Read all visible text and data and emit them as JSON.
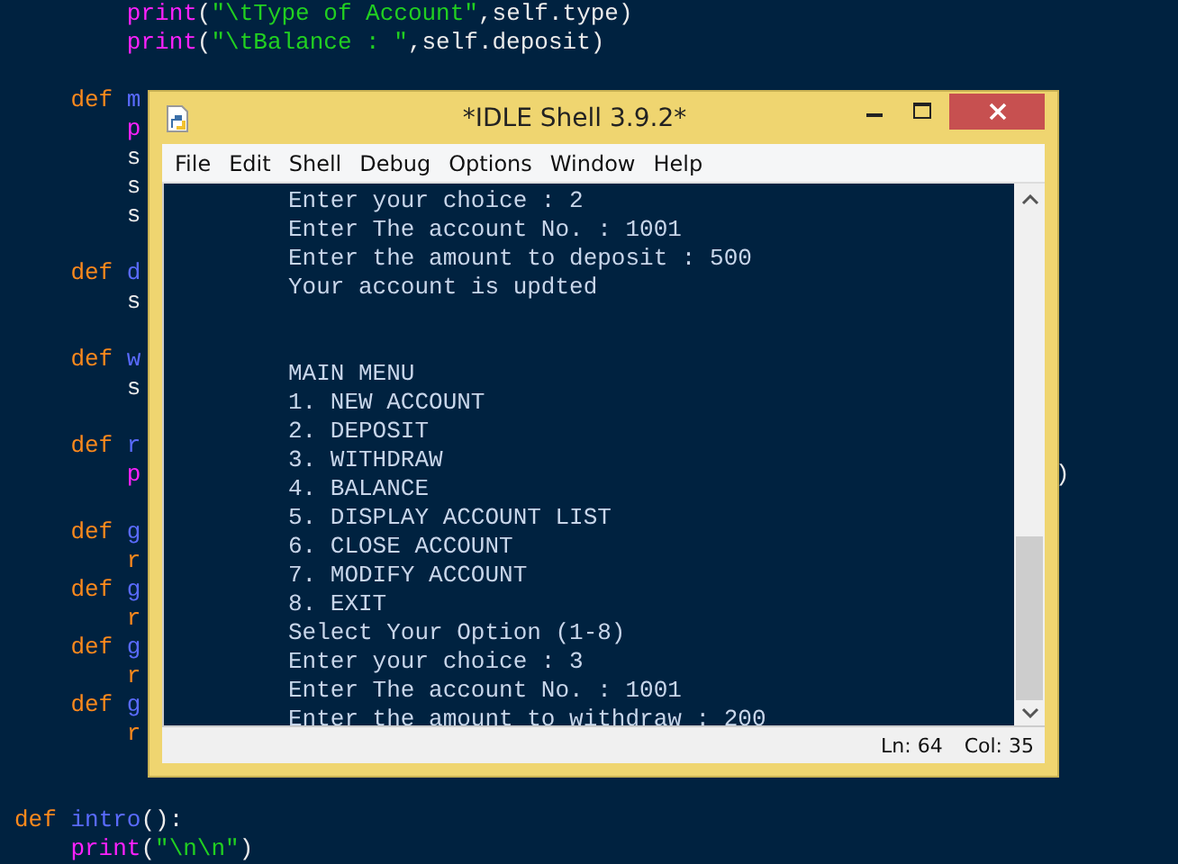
{
  "editor": {
    "lines": [
      {
        "kind": "code",
        "segments": [
          {
            "kind": "builtin",
            "text": "        print"
          },
          {
            "kind": "plain",
            "text": "("
          },
          {
            "kind": "string",
            "text": "\"\\tType of Account\""
          },
          {
            "kind": "plain",
            "text": ",self.type)"
          }
        ]
      },
      {
        "kind": "code",
        "segments": [
          {
            "kind": "builtin",
            "text": "        print"
          },
          {
            "kind": "plain",
            "text": "("
          },
          {
            "kind": "string",
            "text": "\"\\tBalance : \""
          },
          {
            "kind": "plain",
            "text": ",self.deposit)"
          }
        ]
      },
      {
        "kind": "blank"
      },
      {
        "kind": "code",
        "segments": [
          {
            "kind": "keyword",
            "text": "    def "
          },
          {
            "kind": "name",
            "text": "m"
          }
        ]
      },
      {
        "kind": "code",
        "segments": [
          {
            "kind": "builtin",
            "text": "        p"
          }
        ]
      },
      {
        "kind": "code",
        "segments": [
          {
            "kind": "plain",
            "text": "        s"
          }
        ]
      },
      {
        "kind": "code",
        "segments": [
          {
            "kind": "plain",
            "text": "        s"
          }
        ]
      },
      {
        "kind": "code",
        "segments": [
          {
            "kind": "plain",
            "text": "        s"
          }
        ]
      },
      {
        "kind": "blank"
      },
      {
        "kind": "code",
        "segments": [
          {
            "kind": "keyword",
            "text": "    def "
          },
          {
            "kind": "name",
            "text": "d"
          }
        ]
      },
      {
        "kind": "code",
        "segments": [
          {
            "kind": "plain",
            "text": "        s"
          }
        ]
      },
      {
        "kind": "blank"
      },
      {
        "kind": "code",
        "segments": [
          {
            "kind": "keyword",
            "text": "    def "
          },
          {
            "kind": "name",
            "text": "w"
          }
        ]
      },
      {
        "kind": "code",
        "segments": [
          {
            "kind": "plain",
            "text": "        s"
          }
        ]
      },
      {
        "kind": "blank"
      },
      {
        "kind": "code",
        "segments": [
          {
            "kind": "keyword",
            "text": "    def "
          },
          {
            "kind": "name",
            "text": "r"
          }
        ]
      },
      {
        "kind": "code",
        "segments": [
          {
            "kind": "builtin",
            "text": "        p"
          }
        ],
        "right": ")"
      },
      {
        "kind": "blank"
      },
      {
        "kind": "code",
        "segments": [
          {
            "kind": "keyword",
            "text": "    def "
          },
          {
            "kind": "name",
            "text": "g"
          }
        ]
      },
      {
        "kind": "code",
        "segments": [
          {
            "kind": "keyword",
            "text": "        r"
          }
        ]
      },
      {
        "kind": "code",
        "segments": [
          {
            "kind": "keyword",
            "text": "    def "
          },
          {
            "kind": "name",
            "text": "g"
          }
        ]
      },
      {
        "kind": "code",
        "segments": [
          {
            "kind": "keyword",
            "text": "        r"
          }
        ]
      },
      {
        "kind": "code",
        "segments": [
          {
            "kind": "keyword",
            "text": "    def "
          },
          {
            "kind": "name",
            "text": "g"
          }
        ]
      },
      {
        "kind": "code",
        "segments": [
          {
            "kind": "keyword",
            "text": "        r"
          }
        ]
      },
      {
        "kind": "code",
        "segments": [
          {
            "kind": "keyword",
            "text": "    def "
          },
          {
            "kind": "name",
            "text": "g"
          }
        ]
      },
      {
        "kind": "code",
        "segments": [
          {
            "kind": "keyword",
            "text": "        r"
          }
        ]
      },
      {
        "kind": "blank"
      },
      {
        "kind": "blank"
      },
      {
        "kind": "code",
        "segments": [
          {
            "kind": "keyword",
            "text": "def "
          },
          {
            "kind": "name",
            "text": "intro"
          },
          {
            "kind": "plain",
            "text": "():"
          }
        ]
      },
      {
        "kind": "code",
        "segments": [
          {
            "kind": "builtin",
            "text": "    print"
          },
          {
            "kind": "plain",
            "text": "("
          },
          {
            "kind": "string",
            "text": "\"\\n\\n\""
          },
          {
            "kind": "plain",
            "text": ")"
          }
        ]
      }
    ]
  },
  "window": {
    "title": "*IDLE Shell 3.9.2*",
    "menu": [
      "File",
      "Edit",
      "Shell",
      "Debug",
      "Options",
      "Window",
      "Help"
    ],
    "shell_lines": [
      {
        "kind": "text",
        "text": "Enter your choice : 2"
      },
      {
        "kind": "text",
        "text": "Enter The account No. : 1001"
      },
      {
        "kind": "text",
        "text": "Enter the amount to deposit : 500"
      },
      {
        "kind": "text",
        "text": "Your account is updted"
      },
      {
        "kind": "blank"
      },
      {
        "kind": "blank"
      },
      {
        "kind": "text",
        "text": "MAIN MENU"
      },
      {
        "kind": "text",
        "text": "1. NEW ACCOUNT"
      },
      {
        "kind": "text",
        "text": "2. DEPOSIT"
      },
      {
        "kind": "text",
        "text": "3. WITHDRAW"
      },
      {
        "kind": "text",
        "text": "4. BALANCE"
      },
      {
        "kind": "text",
        "text": "5. DISPLAY ACCOUNT LIST"
      },
      {
        "kind": "text",
        "text": "6. CLOSE ACCOUNT"
      },
      {
        "kind": "text",
        "text": "7. MODIFY ACCOUNT"
      },
      {
        "kind": "text",
        "text": "8. EXIT"
      },
      {
        "kind": "text",
        "text": "Select Your Option (1-8)"
      },
      {
        "kind": "text",
        "text": "Enter your choice : 3"
      },
      {
        "kind": "text",
        "text": "Enter The account No. : 1001"
      },
      {
        "kind": "text",
        "text": "Enter the amount to withdraw : 200"
      }
    ],
    "status": {
      "line": "Ln: 64",
      "column": "Col: 35"
    }
  }
}
